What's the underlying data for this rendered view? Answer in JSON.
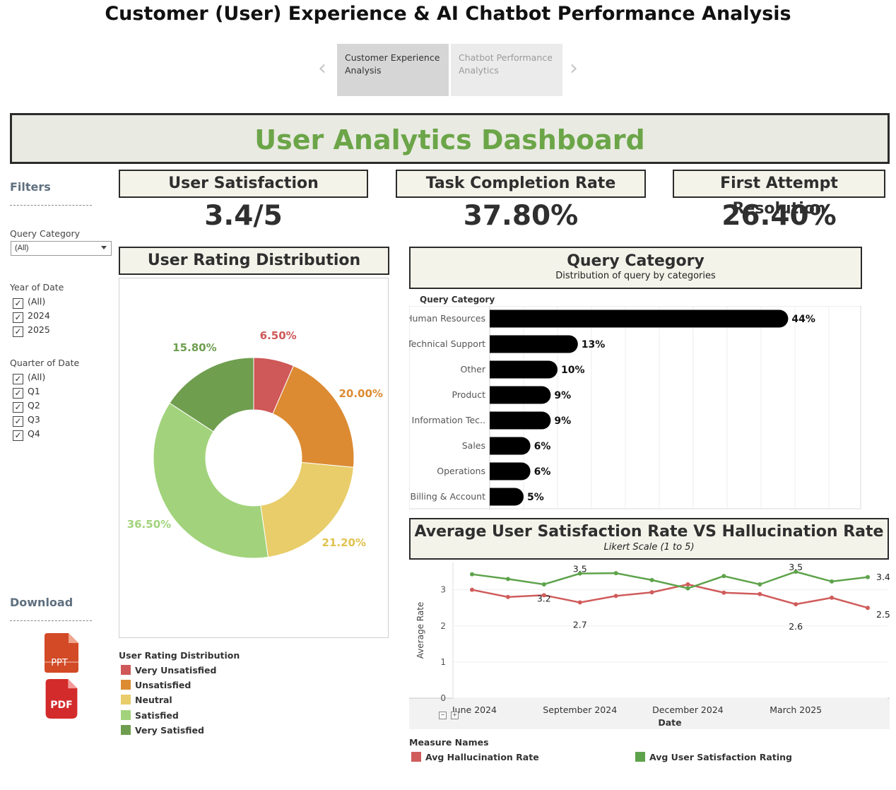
{
  "page_title": "Customer (User) Experience & AI Chatbot Performance Analysis",
  "tabs": [
    {
      "label": "Customer Experience Analysis",
      "active": true
    },
    {
      "label": "Chatbot Performance Analytics",
      "active": false
    }
  ],
  "nav_icons": {
    "prev": "chevron-left-icon",
    "next": "chevron-right-icon"
  },
  "dashboard_title": "User Analytics Dashboard",
  "sidebar": {
    "filters_heading": "Filters",
    "separator": "--------------------",
    "query_category": {
      "label": "Query Category",
      "selected": "(All)"
    },
    "year_of_date": {
      "label": "Year of Date",
      "options": [
        "(All)",
        "2024",
        "2025"
      ],
      "checked": [
        true,
        true,
        true
      ]
    },
    "quarter_of_date": {
      "label": "Quarter of Date",
      "options": [
        "(All)",
        "Q1",
        "Q2",
        "Q3",
        "Q4"
      ],
      "checked": [
        true,
        true,
        true,
        true,
        true
      ]
    },
    "download_heading": "Download",
    "download_buttons": [
      {
        "label": "PPT",
        "icon": "ppt-file-icon",
        "color": "#d24a26"
      },
      {
        "label": "PDF",
        "icon": "pdf-file-icon",
        "color": "#d32b2b"
      }
    ]
  },
  "kpis": [
    {
      "title": "User Satisfaction",
      "value": "3.4/5"
    },
    {
      "title": "Task Completion Rate",
      "value": "37.80%"
    },
    {
      "title": "First Attempt Resolution",
      "value": "26.40%"
    }
  ],
  "rating_distribution": {
    "title": "User Rating Distribution",
    "legend_title": "User Rating Distribution"
  },
  "query_category_panel": {
    "title": "Query Category",
    "subtitle": "Distribution of query by categories",
    "axis_header": "Query Category"
  },
  "line_panel": {
    "title": "Average User Satisfaction Rate VS Hallucination Rate",
    "subtitle": "Likert Scale (1 to 5)",
    "legend_title": "Measure Names"
  },
  "colors": {
    "accent_green": "#6ba548",
    "very_unsatisfied": "#cf5858",
    "unsatisfied": "#dc8b33",
    "neutral": "#e8cd6a",
    "satisfied": "#a2d37c",
    "very_satisfied": "#6f9e4f",
    "bar": "#000000",
    "hallucination": "#d05c5c",
    "satisfaction": "#5ea34b"
  },
  "chart_data": [
    {
      "type": "pie",
      "title": "User Rating Distribution",
      "categories": [
        "Very Unsatisfied",
        "Unsatisfied",
        "Neutral",
        "Satisfied",
        "Very Satisfied"
      ],
      "values": [
        6.5,
        20.0,
        21.2,
        36.5,
        15.8
      ],
      "labels": [
        "6.50%",
        "20.00%",
        "21.20%",
        "36.50%",
        "15.80%"
      ],
      "donut": true,
      "legend_position": "bottom"
    },
    {
      "type": "bar",
      "orientation": "horizontal",
      "title": "Query Category",
      "subtitle": "Distribution of query by categories",
      "ylabel": "Query Category",
      "categories": [
        "Human Resources",
        "Technical Support",
        "Other",
        "Product",
        "Information Tec..",
        "Sales",
        "Operations",
        "Billing & Account"
      ],
      "values": [
        44,
        13,
        10,
        9,
        9,
        6,
        6,
        5
      ],
      "labels": [
        "44%",
        "13%",
        "10%",
        "9%",
        "9%",
        "6%",
        "6%",
        "5%"
      ],
      "xlim": [
        0,
        50
      ],
      "grid": true
    },
    {
      "type": "line",
      "title": "Average User Satisfaction Rate VS Hallucination Rate",
      "subtitle": "Likert Scale (1 to 5)",
      "xlabel": "Date",
      "ylabel": "Average Rate",
      "x": [
        "2024-06",
        "2024-07",
        "2024-08",
        "2024-09",
        "2024-10",
        "2024-11",
        "2024-12",
        "2025-01",
        "2025-02",
        "2025-03",
        "2025-04",
        "2025-05"
      ],
      "x_ticks": [
        "June 2024",
        "September 2024",
        "December 2024",
        "March 2025"
      ],
      "y_ticks": [
        "0",
        "1",
        "2",
        "3"
      ],
      "ylim": [
        0,
        3.6
      ],
      "grid": true,
      "legend_position": "bottom",
      "series": [
        {
          "name": "Avg Hallucination Rate",
          "values": [
            3.0,
            2.8,
            2.85,
            2.65,
            2.83,
            2.93,
            3.15,
            2.92,
            2.88,
            2.6,
            2.78,
            2.5
          ],
          "point_labels": {
            "2": "3.2",
            "3": "2.7",
            "9": "2.6",
            "11": "2.5"
          }
        },
        {
          "name": "Avg User Satisfaction Rating",
          "values": [
            3.43,
            3.3,
            3.15,
            3.45,
            3.46,
            3.27,
            3.04,
            3.38,
            3.15,
            3.5,
            3.23,
            3.35
          ],
          "point_labels": {
            "3": "3.5",
            "9": "3.5",
            "11": "3.4"
          }
        }
      ]
    }
  ]
}
